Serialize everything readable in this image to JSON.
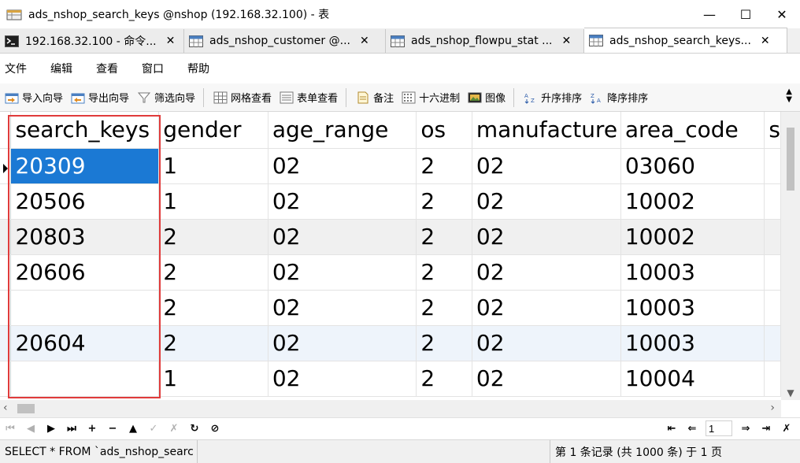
{
  "window": {
    "title": "ads_nshop_search_keys @nshop (192.168.32.100) - 表",
    "minimize": "—",
    "maximize": "☐",
    "close": "✕"
  },
  "tabs": [
    {
      "label": "192.168.32.100 - 命令...",
      "icon": "terminal-icon"
    },
    {
      "label": "ads_nshop_customer @...",
      "icon": "table-icon"
    },
    {
      "label": "ads_nshop_flowpu_stat ...",
      "icon": "table-icon"
    },
    {
      "label": "ads_nshop_search_keys...",
      "icon": "table-icon",
      "active": true
    }
  ],
  "tab_close": "✕",
  "menu": [
    "文件",
    "编辑",
    "查看",
    "窗口",
    "帮助"
  ],
  "toolbar": {
    "import_wizard": "导入向导",
    "export_wizard": "导出向导",
    "filter_wizard": "筛选向导",
    "grid_view": "网格查看",
    "form_view": "表单查看",
    "memo": "备注",
    "hex": "十六进制",
    "image": "图像",
    "sort_asc": "升序排序",
    "sort_desc": "降序排序"
  },
  "table": {
    "columns": [
      "search_keys",
      "gender",
      "age_range",
      "os",
      "manufacture",
      "area_code",
      "s"
    ],
    "rows": [
      [
        "20309",
        "1",
        "02",
        "2",
        "02",
        "03060"
      ],
      [
        "20506",
        "1",
        "02",
        "2",
        "02",
        "10002"
      ],
      [
        "20803",
        "2",
        "02",
        "2",
        "02",
        "10002"
      ],
      [
        "20606",
        "2",
        "02",
        "2",
        "02",
        "10003"
      ],
      [
        "",
        "2",
        "02",
        "2",
        "02",
        "10003"
      ],
      [
        "20604",
        "2",
        "02",
        "2",
        "02",
        "10003"
      ],
      [
        "",
        "1",
        "02",
        "2",
        "02",
        "10004"
      ]
    ]
  },
  "nav": {
    "page": "1"
  },
  "status": {
    "sql": "SELECT * FROM `ads_nshop_searc",
    "records": "第 1 条记录 (共 1000 条) 于 1 页"
  },
  "colors": {
    "selection": "#1b79d4",
    "highlight_border": "#e03b3b"
  }
}
